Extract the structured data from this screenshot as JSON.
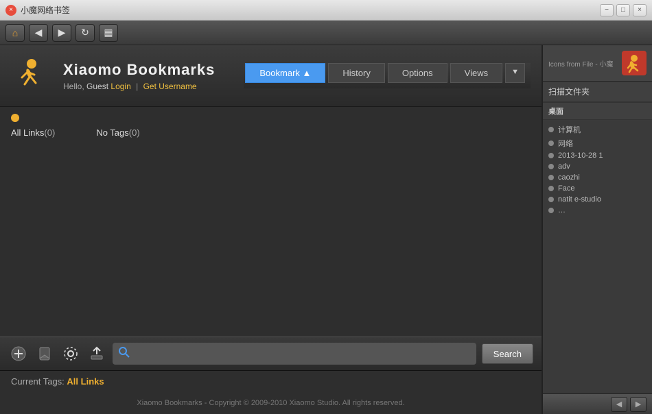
{
  "titleBar": {
    "icon": "×",
    "title": "小魔网络书签",
    "controls": [
      "−",
      "□",
      "×"
    ]
  },
  "navBar": {
    "homeIcon": "⌂",
    "backIcon": "◀",
    "forwardIcon": "▶",
    "refreshIcon": "↻",
    "menuIcon": "▦"
  },
  "header": {
    "brandTitle": "Xiaomo  Bookmarks",
    "greeting": "Hello,",
    "guestLabel": "Guest",
    "loginLabel": "Login",
    "separator": "|",
    "getUsernameLabel": "Get Username"
  },
  "tabs": [
    {
      "id": "bookmark",
      "label": "Bookmark ▲",
      "active": true
    },
    {
      "id": "history",
      "label": "History",
      "active": false
    },
    {
      "id": "options",
      "label": "Options",
      "active": false
    },
    {
      "id": "views",
      "label": "Views",
      "active": false
    }
  ],
  "content": {
    "allLinksLabel": "All Links",
    "allLinksCount": "(0)",
    "noTagsLabel": "No Tags",
    "noTagsCount": "(0)"
  },
  "toolbar": {
    "addIcon": "+",
    "bookmarkIcon": "🔖",
    "settingsIcon": "⚙",
    "uploadIcon": "⬆",
    "searchPlaceholder": "",
    "searchLabel": "Search"
  },
  "currentTags": {
    "label": "Current Tags:",
    "value": "All Links"
  },
  "footer": {
    "text": "Xiaomo Bookmarks - Copyright © 2009-2010 Xiaomo Studio. All rights reserved."
  },
  "rightPanel": {
    "scanFilesLabel": "扫描文件夹",
    "desktopLabel": "桌面",
    "items": [
      {
        "label": "计算机"
      },
      {
        "label": "网络"
      },
      {
        "label": "2013-10-28 1"
      },
      {
        "label": "adv"
      },
      {
        "label": "caozhi"
      },
      {
        "label": "Face"
      },
      {
        "label": "natit e-studio"
      },
      {
        "label": "…"
      }
    ]
  },
  "colors": {
    "accent": "#4a9af0",
    "orange": "#f0b030",
    "red": "#e74c3c"
  }
}
